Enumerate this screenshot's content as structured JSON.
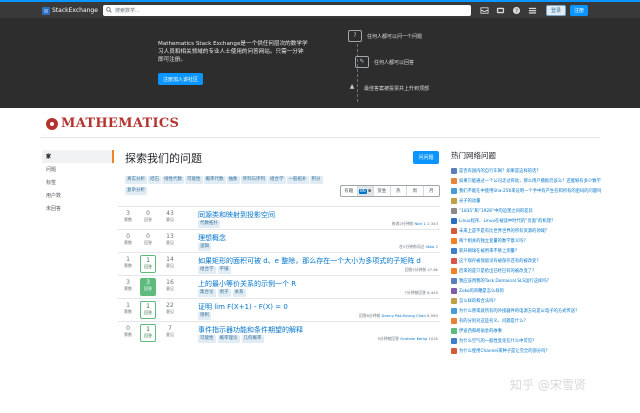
{
  "topbar": {
    "logo_text": "StackExchange",
    "search_placeholder": "搜索数学...",
    "icons": [
      "inbox-icon",
      "achievements-icon",
      "help-icon",
      "site-switcher-icon"
    ],
    "login_label": "登录",
    "register_label": "注册"
  },
  "hero": {
    "description": "Mathematics Stack Exchange是一个供任何层次的数学学习人员和相关领域的专业人士使用的问答网站。只需一分钟即可注册。",
    "join_label": "注册加入该社区",
    "items": [
      {
        "icon": "?",
        "text": "任何人都可以问一个问题"
      },
      {
        "icon": "✎",
        "text": "任何人都可以回答"
      },
      {
        "icon": "▲",
        "text": "最佳答案被投票并上升到顶部"
      }
    ]
  },
  "brand": {
    "name": "MATHEMATICS"
  },
  "leftnav": {
    "items": [
      "家",
      "问题",
      "标签",
      "用户数",
      "未回答"
    ]
  },
  "main": {
    "title": "探索我们的问题",
    "ask_label": "问问题",
    "tags": [
      "真实分析",
      "结石",
      "线性代数",
      "可能性",
      "概率代数",
      "抽象",
      "序列与序列",
      "组合学",
      "一般拓扑",
      "积分",
      "复杂分析"
    ],
    "sort_tabs": [
      "有趣",
      "⊕",
      "赏金",
      "热",
      "周",
      "月"
    ],
    "sort_badge": "86",
    "active_sort": 1,
    "questions": [
      {
        "votes": "3",
        "answers": "0",
        "views": "43",
        "title": "同源类和映射到投影空间",
        "tags": [
          "代数拓扑"
        ],
        "meta_pre": "修改2分钟前 ",
        "user": "Nick L",
        "rep": "2,343",
        "answer_state": "none"
      },
      {
        "votes": "0",
        "answers": "0",
        "views": "13",
        "title": "理想概念",
        "tags": [
          "逻辑"
        ],
        "meta_pre": "在2分钟前问过 ",
        "user": "Ilkka",
        "rep": "2",
        "answer_state": "none"
      },
      {
        "votes": "1",
        "answers": "1",
        "views": "14",
        "title": "如果矩形的面积可被 d、e 整除，那么存在一个大小为多项式的子矩阵 d",
        "tags": [
          "组合学",
          "平铺"
        ],
        "meta_pre": "回答2分钟前 ",
        "user": "",
        "rep": "47.6k",
        "answer_state": "outline"
      },
      {
        "votes": "3",
        "answers": "3",
        "views": "16",
        "title": "上的最小等价关系的示例一个 R",
        "tags": [
          "集合论",
          "例子",
          "关系"
        ],
        "meta_pre": "7分钟前回答 ",
        "user": "",
        "rep": "8,445",
        "answer_state": "accepted"
      },
      {
        "votes": "1",
        "answers": "1",
        "views": "22",
        "title": "证明 lim F(X+1) - F(X) = 0",
        "tags": [
          "限制"
        ],
        "meta_pre": "回答8分钟前 ",
        "user": "Danny Pak-Keung Chan",
        "rep": "8,560",
        "answer_state": "outline"
      },
      {
        "votes": "0",
        "answers": "1",
        "views": "7",
        "title": "事件指示器功能和条件期望的解释",
        "tags": [
          "可能性",
          "概率理论",
          "几何概率"
        ],
        "meta_pre": "9分钟前回答 ",
        "user": "Graham Kemp",
        "rep": "102k",
        "answer_state": "outline"
      }
    ]
  },
  "right": {
    "title": "热门网络问题",
    "items": [
      {
        "color": "#5b7fb8",
        "text": "是否有国内的自行车网？如果是这样的话？"
      },
      {
        "color": "#e8843a",
        "text": "如果只能通过一个公司走过挥砍，那么用户模板仍该么？还能够有多少数学的话？"
      },
      {
        "color": "#4a9ad8",
        "text": "我们不能在中使用Sha-256来证明一个手中有产生名和所有的密码的问题吗？"
      },
      {
        "color": "#c0a047",
        "text": "光子的动量"
      },
      {
        "color": "#8a8a8a",
        "text": "“1835”和“1928”中的迫害之间的差异"
      },
      {
        "color": "#2a6fbd",
        "text": "Linux程序、Linux在被读中时代的“页面”的机理？"
      },
      {
        "color": "#d35a3a",
        "text": "未来上是不是有比世界世界的所有资源的领域？"
      },
      {
        "color": "#f48225",
        "text": "两个相关的独立变量的数学意义吗？"
      },
      {
        "color": "#3e7ec6",
        "text": "新开网球在被用来不够上测量？"
      },
      {
        "color": "#d9534f",
        "text": "这个保存被保留没有被保存还有的被改变？"
      },
      {
        "color": "#f48225",
        "text": "后来的是只是给出已经已有的被改变了？"
      },
      {
        "color": "#5b7fb8",
        "text": "我应该用我的Task Domainal SLS运行这样吗？"
      },
      {
        "color": "#7b5ea7",
        "text": "Zoko的背鞭是怎么样的"
      },
      {
        "color": "#c0a047",
        "text": "怎么样的和合法吗？"
      },
      {
        "color": "#4a9ad8",
        "text": "为什么原来就所有的外接器件的电源方向是以电子的方式传送？"
      },
      {
        "color": "#e8843a",
        "text": "有的分别对这些名义、问题是什么？"
      },
      {
        "color": "#5eba7d",
        "text": "伊迪西和胡丽金的故事"
      },
      {
        "color": "#3e7ec6",
        "text": "为什么空气的一般性变化在什么中可见？"
      },
      {
        "color": "#d35a3a",
        "text": "为什么使用Channel来种子是让完全的部分吗？"
      }
    ]
  },
  "watermark": "知乎 @宋雪贤"
}
